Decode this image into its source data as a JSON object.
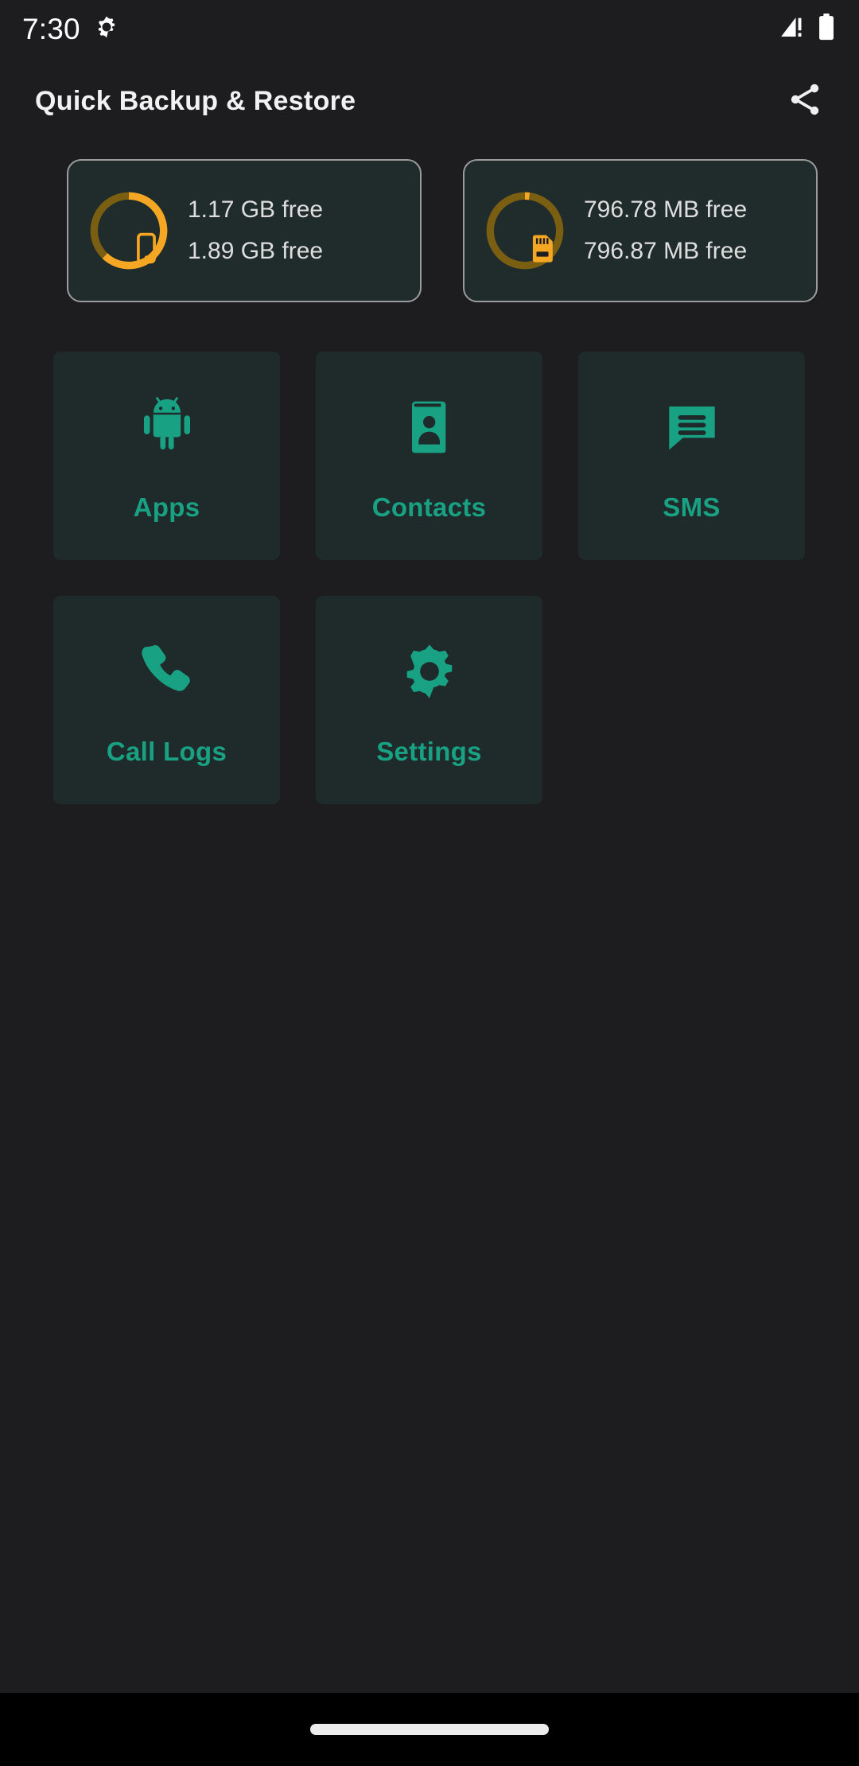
{
  "theme": {
    "page_bg": "#1d1d1f",
    "tile_bg": "#1e2b2a",
    "accent_teal": "#19a184",
    "accent_orange": "#f5a623",
    "ring_track": "#7a5e12",
    "text_light": "#dedede",
    "card_border": "#9b9b9b"
  },
  "status_bar": {
    "time": "7:30",
    "left_icon": "gear-icon",
    "signal_icon": "signal-warning-icon",
    "battery_icon": "battery-full-icon"
  },
  "app_bar": {
    "title": "Quick Backup & Restore",
    "share_icon": "share-icon"
  },
  "storage": [
    {
      "icon": "phone-storage-icon",
      "ring_percent": 62,
      "line1": "1.17 GB free",
      "line2": "1.89 GB free"
    },
    {
      "icon": "sd-card-icon",
      "ring_percent": 2,
      "line1": "796.78 MB free",
      "line2": "796.87 MB free"
    }
  ],
  "tiles": [
    {
      "label": "Apps",
      "icon": "android-robot-icon"
    },
    {
      "label": "Contacts",
      "icon": "contacts-book-icon"
    },
    {
      "label": "SMS",
      "icon": "message-bubble-icon"
    },
    {
      "label": "Call Logs",
      "icon": "phone-handset-icon"
    },
    {
      "label": "Settings",
      "icon": "gear-icon"
    }
  ],
  "nav_bar": {
    "handle": "gesture-home-pill"
  }
}
